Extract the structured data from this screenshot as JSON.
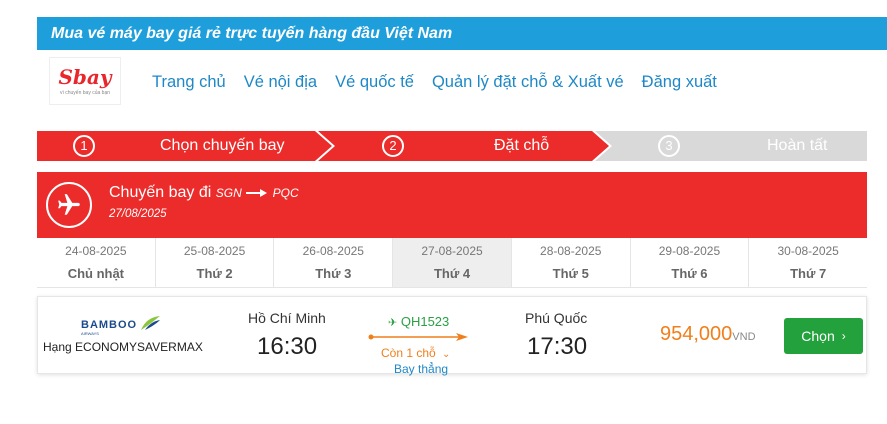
{
  "banner": {
    "tagline": "Mua vé máy bay giá rẻ trực tuyến hàng đầu Việt Nam"
  },
  "logo": {
    "text": "Sbay",
    "slogan": "vì chuyến bay của bạn"
  },
  "nav": {
    "items": [
      {
        "label": "Trang chủ"
      },
      {
        "label": "Vé nội địa"
      },
      {
        "label": "Vé quốc tế"
      },
      {
        "label": "Quản lý đặt chỗ & Xuất vé"
      },
      {
        "label": "Đăng xuất"
      }
    ]
  },
  "steps": [
    {
      "num": "1",
      "label": "Chọn chuyến bay",
      "active": true
    },
    {
      "num": "2",
      "label": "Đặt chỗ",
      "active": true
    },
    {
      "num": "3",
      "label": "Hoàn tất",
      "active": false
    }
  ],
  "flight_header": {
    "title": "Chuyến bay đi",
    "from": "SGN",
    "to": "PQC",
    "date": "27/08/2025"
  },
  "dates": [
    {
      "date": "24-08-2025",
      "weekday": "Chủ nhật",
      "selected": false
    },
    {
      "date": "25-08-2025",
      "weekday": "Thứ 2",
      "selected": false
    },
    {
      "date": "26-08-2025",
      "weekday": "Thứ 3",
      "selected": false
    },
    {
      "date": "27-08-2025",
      "weekday": "Thứ 4",
      "selected": true
    },
    {
      "date": "28-08-2025",
      "weekday": "Thứ 5",
      "selected": false
    },
    {
      "date": "29-08-2025",
      "weekday": "Thứ 6",
      "selected": false
    },
    {
      "date": "30-08-2025",
      "weekday": "Thứ 7",
      "selected": false
    }
  ],
  "result": {
    "airline": "BAMBOO",
    "airline_sub": "AIRWAYS",
    "fare_class": "Hạng ECONOMYSAVERMAX",
    "depart_city": "Hồ Chí Minh",
    "depart_time": "16:30",
    "flight_no": "QH1523",
    "seats_left": "Còn 1 chỗ",
    "stops": "Bay thẳng",
    "arrive_city": "Phú Quốc",
    "arrive_time": "17:30",
    "price": "954,000",
    "currency": "VND",
    "choose_label": "Chọn"
  },
  "colors": {
    "banner_blue": "#1e9fdb",
    "step_red": "#ec2b2b",
    "step_grey": "#d9d9d9",
    "link_blue": "#1e88c7",
    "price_orange": "#f07f1b",
    "button_green": "#23a13c"
  },
  "icons": {
    "plane": "airplane-icon",
    "arrow": "arrow-right-icon",
    "chevron": "chevron-right-icon"
  }
}
